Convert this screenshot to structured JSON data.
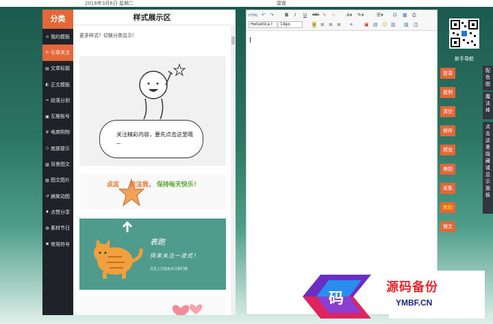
{
  "topbar": {
    "date": "2018年3月6日 星期二",
    "right_text": "雷霆"
  },
  "categories": {
    "header": "分类",
    "items": [
      {
        "icon": "home-icon",
        "glyph": "⌂",
        "label": "我的模板"
      },
      {
        "icon": "guide-icon",
        "glyph": "↻",
        "label": "引导关注"
      },
      {
        "icon": "title-icon",
        "glyph": "▤",
        "label": "文章标题"
      },
      {
        "icon": "template-icon",
        "glyph": "◐",
        "label": "正文模板"
      },
      {
        "icon": "divider-icon",
        "glyph": "━",
        "label": "段落分割"
      },
      {
        "icon": "account-icon",
        "glyph": "▣",
        "label": "互推账号"
      },
      {
        "icon": "shop-icon",
        "glyph": "₽",
        "label": "电商购物"
      },
      {
        "icon": "bottom-icon",
        "glyph": "◇",
        "label": "底部提示"
      },
      {
        "icon": "image-icon",
        "glyph": "▨",
        "label": "背景图文"
      },
      {
        "icon": "picture-icon",
        "glyph": "▨",
        "label": "图文图片"
      },
      {
        "icon": "gif-icon",
        "glyph": "↺",
        "label": "搞笑动图"
      },
      {
        "icon": "like-icon",
        "glyph": "♦",
        "label": "点赞分享"
      },
      {
        "icon": "gift-icon",
        "glyph": "✿",
        "label": "素材节日"
      },
      {
        "icon": "symbol-icon",
        "glyph": "✱",
        "label": "常用符号"
      }
    ]
  },
  "panel": {
    "title": "样式展示区",
    "more_text": "更多样式？切换分类显示！",
    "bubble_text": "关注精彩内容，要先点击这里哦~",
    "banner": {
      "a": "点这",
      "b": "关注我，",
      "c": "保持每天快乐！"
    },
    "card3": {
      "title": "表跑",
      "subtitle": "快来关注一波式！",
      "tiny": "点击上方蓝色关注我们哦"
    }
  },
  "editor": {
    "toolbar": {
      "html": "HTML",
      "bold": "B",
      "italic": "I",
      "underline": "U",
      "strike": "ABC",
      "font_family": "Helvetica I",
      "font_size": "14px"
    }
  },
  "right": {
    "qr_label": "新手导航",
    "buttons": [
      {
        "label": "登录",
        "highlight": false
      },
      {
        "label": "复制",
        "highlight": false
      },
      {
        "label": "清空",
        "highlight": false
      },
      {
        "label": "保存",
        "highlight": false
      },
      {
        "label": "预览",
        "highlight": false
      },
      {
        "label": "美图",
        "highlight": false
      },
      {
        "label": "采集",
        "highlight": false
      },
      {
        "label": "教程",
        "highlight": true
      },
      {
        "label": "微文",
        "highlight": false
      }
    ],
    "vtabs": [
      {
        "label": "配色图"
      },
      {
        "label": "魔法棒"
      },
      {
        "label": "点击这里隐藏或显示面板"
      }
    ]
  },
  "watermark": {
    "title": "源码备份",
    "url": "YMBF.CN",
    "logo_char": "码"
  },
  "colors": {
    "accent": "#e4673a",
    "sidebar": "#1f2229",
    "teal": "#4f9b8e",
    "yellow": "#ffe400"
  }
}
